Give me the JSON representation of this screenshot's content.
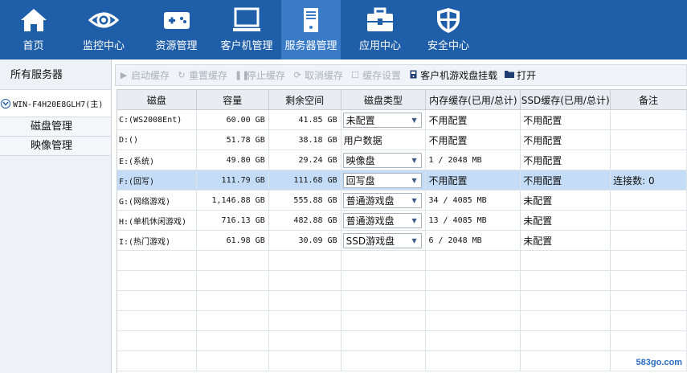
{
  "nav": {
    "items": [
      {
        "label": "首页",
        "icon": "home-icon"
      },
      {
        "label": "监控中心",
        "icon": "eye-icon"
      },
      {
        "label": "资源管理",
        "icon": "gamepad-icon"
      },
      {
        "label": "客户机管理",
        "icon": "monitor-icon"
      },
      {
        "label": "服务器管理",
        "icon": "server-icon"
      },
      {
        "label": "应用中心",
        "icon": "toolbox-icon"
      },
      {
        "label": "安全中心",
        "icon": "shield-icon"
      }
    ],
    "active_label": "服务器管理"
  },
  "sidebar": {
    "header": "所有服务器",
    "server": "WIN-F4H20E8GLH7(主)",
    "items": [
      "磁盘管理",
      "映像管理"
    ]
  },
  "toolbar": {
    "start_cache": "启动缓存",
    "reset_cache": "重置缓存",
    "stop_cache": "停止缓存",
    "cancel_cache": "取消缓存",
    "cache_settings": "缓存设置",
    "client_mount": "客户机游戏盘挂载",
    "open": "打开"
  },
  "table": {
    "columns": [
      "磁盘",
      "容量",
      "剩余空间",
      "磁盘类型",
      "内存缓存(已用/总计)",
      "SSD缓存(已用/总计)",
      "备注"
    ],
    "rows": [
      {
        "disk": "C:(WS2008Ent)",
        "capacity": "60.00 GB",
        "free": "41.85 GB",
        "type": "未配置",
        "type_is_select": true,
        "mem_cache": "不用配置",
        "ssd_cache": "不用配置",
        "note": ""
      },
      {
        "disk": "D:()",
        "capacity": "51.78 GB",
        "free": "38.18 GB",
        "type": "用户数据",
        "type_is_select": false,
        "mem_cache": "不用配置",
        "ssd_cache": "不用配置",
        "note": ""
      },
      {
        "disk": "E:(系统)",
        "capacity": "49.80 GB",
        "free": "29.24 GB",
        "type": "映像盘",
        "type_is_select": true,
        "mem_cache": "1 / 2048 MB",
        "ssd_cache": "不用配置",
        "note": ""
      },
      {
        "disk": "F:(回写)",
        "capacity": "111.79 GB",
        "free": "111.68 GB",
        "type": "回写盘",
        "type_is_select": true,
        "mem_cache": "不用配置",
        "ssd_cache": "不用配置",
        "note": "连接数: 0",
        "selected": true
      },
      {
        "disk": "G:(网络游戏)",
        "capacity": "1,146.88 GB",
        "free": "555.88 GB",
        "type": "普通游戏盘",
        "type_is_select": true,
        "mem_cache": "34 / 4085 MB",
        "ssd_cache": "未配置",
        "note": ""
      },
      {
        "disk": "H:(单机休闲游戏)",
        "capacity": "716.13 GB",
        "free": "482.88 GB",
        "type": "普通游戏盘",
        "type_is_select": true,
        "mem_cache": "13 / 4085 MB",
        "ssd_cache": "未配置",
        "note": ""
      },
      {
        "disk": "I:(热门游戏)",
        "capacity": "61.98 GB",
        "free": "30.09 GB",
        "type": "SSD游戏盘",
        "type_is_select": true,
        "mem_cache": "6 / 2048 MB",
        "ssd_cache": "未配置",
        "note": ""
      }
    ],
    "empty_rows": 6
  },
  "watermark": "583go.com",
  "colors": {
    "nav_bg": "#1f5ea8",
    "nav_active": "#3a7bc8",
    "row_selected": "#c5dcf6"
  }
}
